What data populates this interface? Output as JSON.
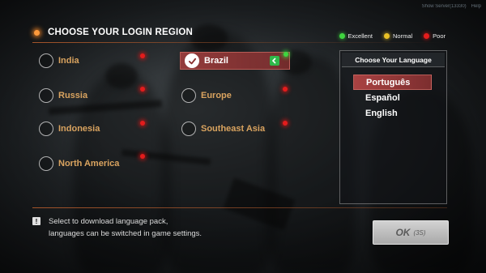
{
  "server_info": {
    "server": "Show Server(13330)",
    "help": "Help"
  },
  "header": {
    "title": "CHOOSE YOUR LOGIN REGION"
  },
  "legend": [
    {
      "label": "Excellent",
      "color": "#3fd63f"
    },
    {
      "label": "Normal",
      "color": "#e8c026"
    },
    {
      "label": "Poor",
      "color": "#e31c1c"
    }
  ],
  "regions": [
    {
      "label": "India",
      "signal": "poor",
      "selected": false
    },
    {
      "label": "Brazil",
      "signal": "excellent",
      "selected": true
    },
    {
      "label": "Russia",
      "signal": "poor",
      "selected": false
    },
    {
      "label": "Europe",
      "signal": "poor",
      "selected": false
    },
    {
      "label": "Indonesia",
      "signal": "poor",
      "selected": false
    },
    {
      "label": "Southeast Asia",
      "signal": "poor",
      "selected": false
    },
    {
      "label": "North America",
      "signal": "poor",
      "selected": false
    }
  ],
  "language_panel": {
    "title": "Choose Your Language",
    "languages": [
      {
        "label": "Português",
        "selected": true
      },
      {
        "label": "Español",
        "selected": false
      },
      {
        "label": "English",
        "selected": false
      }
    ]
  },
  "info": {
    "icon": "!",
    "line1": "Select to download language pack,",
    "line2": "languages can be switched in game settings."
  },
  "ok_button": {
    "label": "OK",
    "countdown": "(3S)"
  }
}
